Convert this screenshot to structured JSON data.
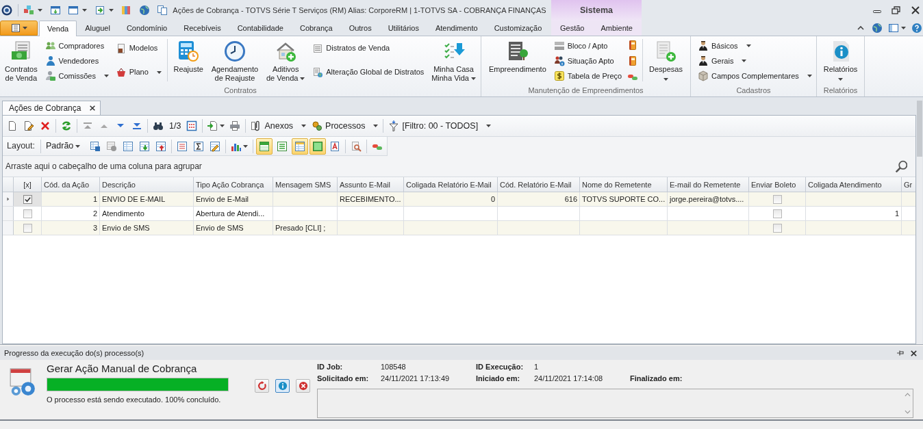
{
  "title_bar": {
    "title": "Ações de Cobrança - TOTVS Série T Serviços (RM) Alias: CorporeRM | 1-TOTVS SA - COBRANÇA FINANÇAS",
    "context_group": "Sistema"
  },
  "ribbon_tabs": [
    {
      "label": "Venda",
      "selected": true
    },
    {
      "label": "Aluguel",
      "selected": false
    },
    {
      "label": "Condomínio",
      "selected": false
    },
    {
      "label": "Recebíveis",
      "selected": false
    },
    {
      "label": "Contabilidade",
      "selected": false
    },
    {
      "label": "Cobrança",
      "selected": false
    },
    {
      "label": "Outros",
      "selected": false
    },
    {
      "label": "Utilitários",
      "selected": false
    },
    {
      "label": "Atendimento",
      "selected": false
    },
    {
      "label": "Customização",
      "selected": false
    }
  ],
  "context_tabs": [
    {
      "label": "Gestão",
      "selected": false
    },
    {
      "label": "Ambiente",
      "selected": false
    }
  ],
  "ribbon_groups": [
    {
      "label": "Contratos",
      "columns": [
        {
          "kind": "large",
          "label": "Contratos\nde Venda",
          "dropdown": false
        },
        {
          "kind": "stack",
          "items": [
            {
              "label": "Compradores",
              "dropdown": false
            },
            {
              "label": "Vendedores",
              "dropdown": false
            },
            {
              "label": "Comissões",
              "dropdown": true
            }
          ]
        },
        {
          "kind": "stack",
          "items": [
            {
              "label": "Modelos",
              "dropdown": false
            },
            {
              "label": "Plano",
              "dropdown": true
            }
          ]
        },
        {
          "kind": "separator"
        },
        {
          "kind": "large",
          "label": "Reajuste",
          "dropdown": false
        },
        {
          "kind": "large",
          "label": "Agendamento\nde Reajuste",
          "dropdown": false
        },
        {
          "kind": "large",
          "label": "Aditivos\nde Venda",
          "dropdown": true
        },
        {
          "kind": "stack",
          "items": [
            {
              "label": "Distratos de Venda",
              "dropdown": false
            },
            {
              "label": "Alteração Global de Distratos",
              "dropdown": false
            }
          ]
        },
        {
          "kind": "large",
          "label": "Minha Casa\nMinha Vida",
          "dropdown": true
        }
      ]
    },
    {
      "label": "Manutenção de Empreendimentos",
      "columns": [
        {
          "kind": "large",
          "label": "Empreendimento",
          "dropdown": false
        },
        {
          "kind": "stack",
          "items": [
            {
              "label": "Bloco / Apto",
              "dropdown": false
            },
            {
              "label": "Situação Apto",
              "dropdown": false
            },
            {
              "label": "Tabela de Preço",
              "dropdown": false
            }
          ]
        },
        {
          "kind": "icon_stack"
        },
        {
          "kind": "separator"
        },
        {
          "kind": "large",
          "label": "Despesas",
          "dropdown": true
        }
      ]
    },
    {
      "label": "Cadastros",
      "columns": [
        {
          "kind": "stack",
          "items": [
            {
              "label": "Básicos",
              "dropdown": true
            },
            {
              "label": "Gerais",
              "dropdown": true
            },
            {
              "label": "Campos Complementares",
              "dropdown": true
            }
          ]
        }
      ]
    },
    {
      "label": "Relatórios",
      "columns": [
        {
          "kind": "large",
          "label": "Relatórios",
          "dropdown": true
        }
      ]
    }
  ],
  "doc_tabs": [
    {
      "label": "Ações de Cobrança",
      "selected": true
    }
  ],
  "toolbar": {
    "record_position": "1/3",
    "menus": [
      {
        "label": "Anexos"
      },
      {
        "label": "Processos"
      },
      {
        "label": "[Filtro: 00 - TODOS]"
      }
    ]
  },
  "view_toolbar": {
    "label": "Layout:",
    "layout": "Padrão",
    "toggles": [
      {
        "on": true
      },
      {
        "on": false
      },
      {
        "on": true
      },
      {
        "on": true
      }
    ]
  },
  "group_panel": {
    "hint": "Arraste aqui o cabeçalho de uma coluna para agrupar"
  },
  "table": {
    "columns": [
      "[x]",
      "Cód. da Ação",
      "Descrição",
      "Tipo Ação Cobrança",
      "Mensagem SMS",
      "Assunto E-Mail",
      "Coligada Relatório E-Mail",
      "Cód. Relatório E-Mail",
      "Nome do Remetente",
      "E-mail do Remetente",
      "Enviar Boleto",
      "Coligada Atendimento",
      "Gr"
    ],
    "rows": [
      {
        "selected": true,
        "checked": true,
        "cod": "1",
        "descricao": "ENVIO DE E-MAIL",
        "tipo": "Envio de E-Mail",
        "assunto_email": "RECEBIMENTO...",
        "coligada_relatorio": "0",
        "cod_relatorio": "616",
        "nome_remetente": "TOTVS SUPORTE CO...",
        "email_remetente": "jorge.pereira@totvs....",
        "enviar_boleto": false
      },
      {
        "selected": false,
        "checked": false,
        "cod": "2",
        "descricao": "Atendimento",
        "tipo": "Abertura de Atendi...",
        "enviar_boleto": false,
        "coligada_atendimento": "1"
      },
      {
        "selected": false,
        "checked": false,
        "cod": "3",
        "descricao": "Envio de SMS",
        "tipo": "Envio de SMS",
        "mensagem_sms": "Presado [CLI] ;",
        "enviar_boleto": false
      }
    ]
  },
  "progress_panel": {
    "title": "Progresso da execução do(s) processo(s)",
    "process_name": "Gerar Ação Manual de Cobrança",
    "level": 1,
    "status": "O processo está sendo executado. 100% concluído.",
    "buttons": [
      {
        "selected": false
      },
      {
        "selected": true
      },
      {
        "selected": false
      }
    ],
    "info_rows": [
      [
        {
          "label": "ID Job:",
          "value": "108548"
        },
        {
          "label": "ID Execução:",
          "value": "1"
        }
      ],
      [
        {
          "label": "Solicitado em:",
          "value": "24/11/2021 17:13:49"
        },
        {
          "label": "Iniciado em:",
          "value": "24/11/2021 17:14:08"
        },
        {
          "label": "Finalizado em:"
        }
      ]
    ]
  }
}
